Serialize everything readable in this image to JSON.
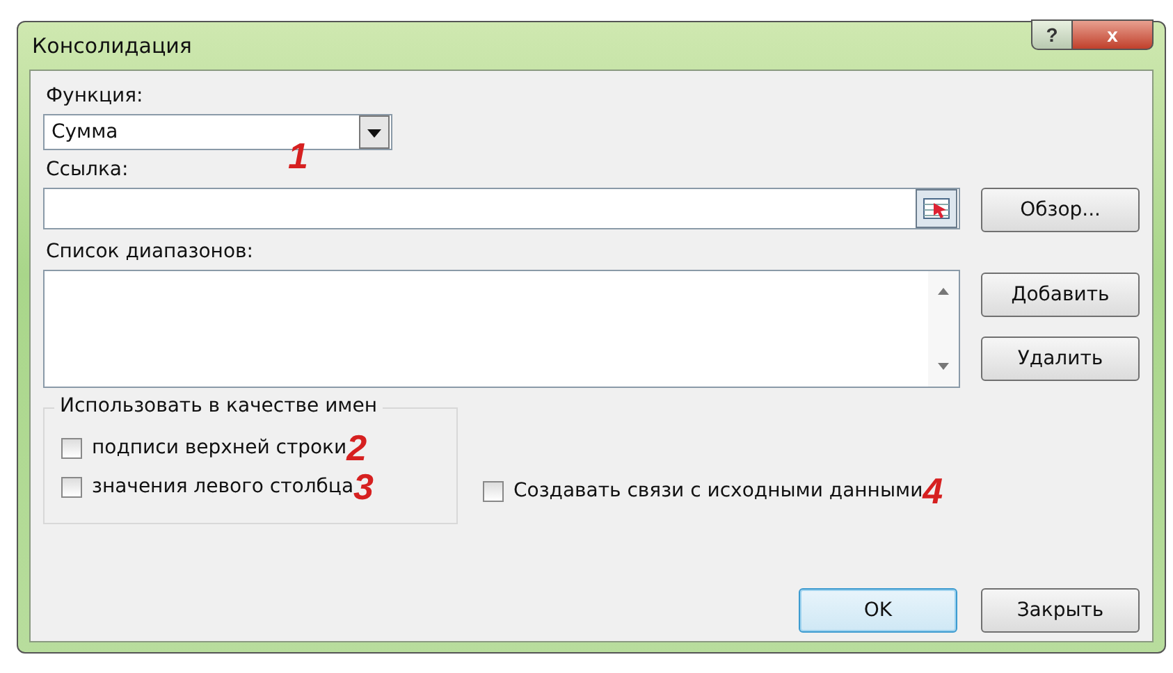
{
  "window": {
    "title": "Консолидация",
    "help_button": "?",
    "close_button": "x"
  },
  "function_field": {
    "label": "Функция:",
    "value": "Сумма",
    "callout": "1"
  },
  "reference_field": {
    "label": "Ссылка:",
    "browse_button": "Обзор..."
  },
  "ranges": {
    "label": "Список диапазонов:",
    "add_button": "Добавить",
    "delete_button": "Удалить"
  },
  "use_labels": {
    "legend": "Использовать в качестве имен",
    "options": [
      {
        "label": "подписи верхней строки",
        "checked": false,
        "callout": "2"
      },
      {
        "label": "значения левого столбца",
        "checked": false,
        "callout": "3"
      }
    ]
  },
  "link_option": {
    "label": "Создавать связи с исходными данными",
    "checked": false,
    "callout": "4"
  },
  "buttons": [
    {
      "label": "OK",
      "selected": true
    },
    {
      "label": "Закрыть",
      "selected": false
    }
  ]
}
